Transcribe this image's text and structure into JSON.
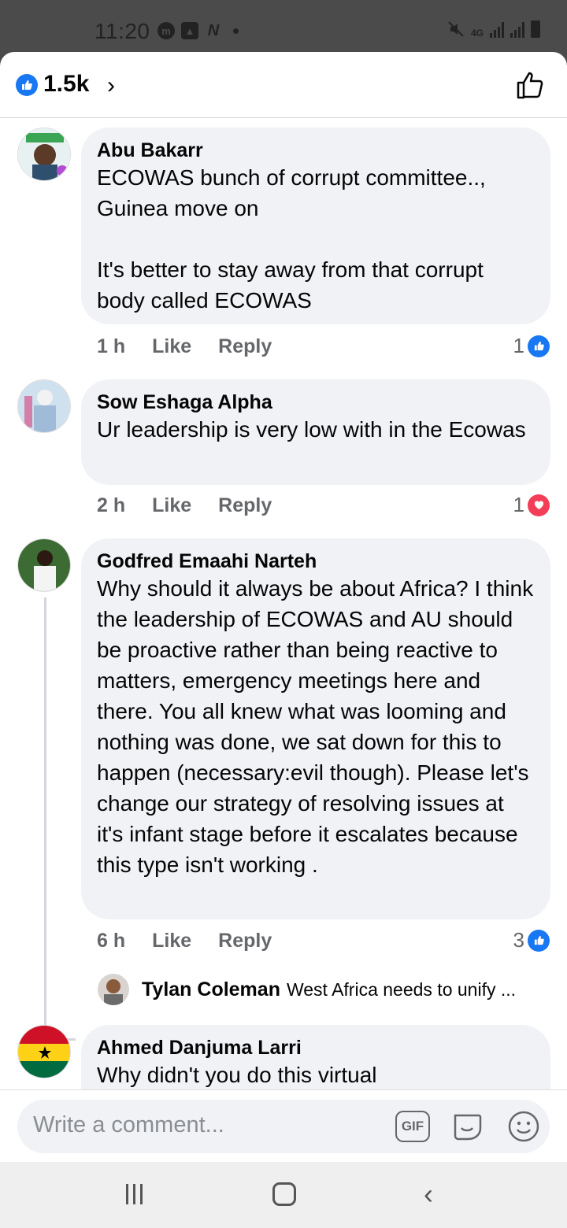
{
  "status_bar": {
    "time": "11:20",
    "network": "4G",
    "icons": [
      "messenger-icon",
      "gallery-icon",
      "n-app-icon",
      "notification-dot",
      "mute-icon",
      "signal-icon",
      "signal-icon",
      "battery-icon"
    ]
  },
  "header": {
    "reaction_count": "1.5k",
    "chevron": "›",
    "like_button_icon": "thumbs-up-outline-icon"
  },
  "comments": [
    {
      "author": "Abu Bakarr",
      "text": "ECOWAS bunch of corrupt committee..,\nGuinea move on\n\nIt's better to stay away from that corrupt body called ECOWAS",
      "time": "1 h",
      "like_label": "Like",
      "reply_label": "Reply",
      "reaction_count": "1",
      "reaction_type": "like"
    },
    {
      "author": "Sow Eshaga Alpha",
      "text": "Ur leadership is very low with in the Ecowas",
      "time": "2 h",
      "like_label": "Like",
      "reply_label": "Reply",
      "reaction_count": "1",
      "reaction_type": "love"
    },
    {
      "author": "Godfred Emaahi Narteh",
      "text": "Why should it always be about Africa? I think the leadership of ECOWAS and AU should be proactive rather than being reactive to matters, emergency meetings here and there. You all knew what was looming and nothing was done, we sat down for this to happen (necessary:evil though). Please let's change our strategy of resolving issues at it's infant stage before it escalates because this type isn't working .",
      "time": "6 h",
      "like_label": "Like",
      "reply_label": "Reply",
      "reaction_count": "3",
      "reaction_type": "like",
      "reply_preview": {
        "author": "Tylan Coleman",
        "text": "West Africa needs to unify ..."
      }
    },
    {
      "author": "Ahmed Danjuma Larri",
      "text": "Why didn't you do this virtual"
    }
  ],
  "composer": {
    "placeholder": "Write a comment...",
    "gif_label": "GIF"
  },
  "colors": {
    "facebook_blue": "#1877f2",
    "love_red": "#f33e58",
    "bubble_gray": "#f0f2f5",
    "meta_gray": "#65676b"
  }
}
